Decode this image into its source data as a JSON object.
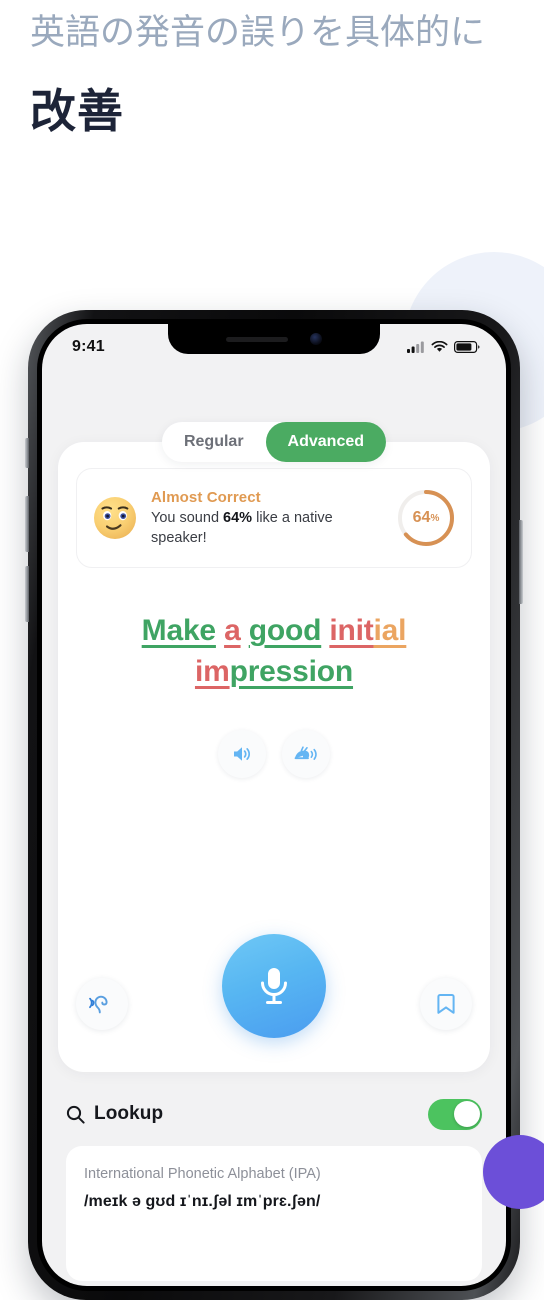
{
  "headline": {
    "sub": "英語の発音の誤りを具体的に",
    "main": "改善"
  },
  "phone": {
    "status_bar": {
      "time": "9:41",
      "cellular_icon": "signal-bars-icon",
      "wifi_icon": "wifi-icon",
      "battery_icon": "battery-icon"
    },
    "tabs": [
      {
        "label": "Regular",
        "active": false
      },
      {
        "label": "Advanced",
        "active": true
      }
    ],
    "score_card": {
      "emoji": "slightly-smiling-face",
      "title": "Almost Correct",
      "desc_before": "You sound ",
      "desc_value": "64%",
      "desc_after": " like a native speaker!",
      "ring_value": 64,
      "ring_label": "64",
      "ring_suffix": "%",
      "ring_color": "#d79154",
      "title_color": "#e09a52"
    },
    "sentence": {
      "line1": [
        {
          "text": "Make",
          "color": "green"
        },
        {
          "text": " ",
          "color": "none"
        },
        {
          "text": "a",
          "color": "red"
        },
        {
          "text": " ",
          "color": "none"
        },
        {
          "text": "good",
          "color": "green"
        },
        {
          "text": " ",
          "color": "none"
        },
        {
          "text": "init",
          "color": "red"
        },
        {
          "text": "ial",
          "color": "orange"
        }
      ],
      "line2": [
        {
          "text": "im",
          "color": "red"
        },
        {
          "text": "pression",
          "color": "green"
        }
      ],
      "colors": {
        "green": "#3fa463",
        "red": "#dc6565",
        "orange": "#eba561"
      }
    },
    "audio_buttons": [
      {
        "icon": "speaker-icon",
        "name": "play-audio-button"
      },
      {
        "icon": "snail-slow-audio-icon",
        "name": "play-slow-audio-button"
      }
    ],
    "actions": {
      "listen_icon": "ear-listen-icon",
      "record_icon": "microphone-icon",
      "bookmark_icon": "bookmark-icon"
    },
    "lookup": {
      "icon": "search-icon",
      "label": "Lookup",
      "toggle_on": true,
      "toggle_color": "#4cc35f"
    },
    "ipa_card": {
      "title": "International Phonetic Alphabet (IPA)",
      "value": "/meɪk ə gʊd ɪˈnɪ.ʃəl ɪmˈprɛ.ʃən/"
    }
  }
}
